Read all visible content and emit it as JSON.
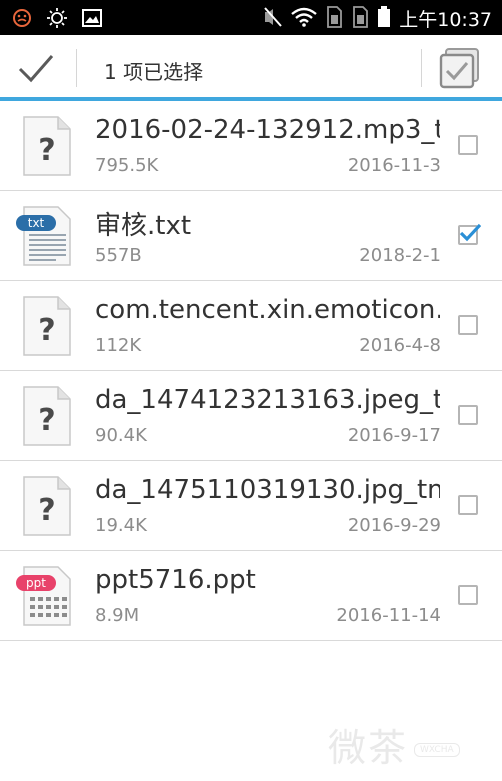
{
  "status_bar": {
    "time": "上午10:37",
    "left_icons": [
      "emoji-icon",
      "brightness-icon",
      "image-icon"
    ],
    "right_icons": [
      "mute-icon",
      "wifi-icon",
      "sim1-icon",
      "sim2-icon",
      "battery-icon"
    ]
  },
  "action_bar": {
    "title": "1 项已选择"
  },
  "colors": {
    "accent": "#3fa7de",
    "checkbox_checked": "#2a8fd6",
    "text_primary": "#333333",
    "text_secondary": "#8c8c8c"
  },
  "files": [
    {
      "name": "2016-02-24-132912.mp3_t",
      "size": "795.5K",
      "date": "2016-11-3",
      "icon": "unknown-file-icon",
      "checked": false
    },
    {
      "name": "审核.txt",
      "size": "557B",
      "date": "2018-2-1",
      "icon": "txt-file-icon",
      "icon_label": "txt",
      "checked": true
    },
    {
      "name": "com.tencent.xin.emoticon.",
      "size": "112K",
      "date": "2016-4-8",
      "icon": "unknown-file-icon",
      "checked": false
    },
    {
      "name": "da_1474123213163.jpeg_t",
      "size": "90.4K",
      "date": "2016-9-17",
      "icon": "unknown-file-icon",
      "checked": false
    },
    {
      "name": "da_1475110319130.jpg_tn",
      "size": "19.4K",
      "date": "2016-9-29",
      "icon": "unknown-file-icon",
      "checked": false
    },
    {
      "name": "ppt5716.ppt",
      "size": "8.9M",
      "date": "2016-11-14",
      "icon": "ppt-file-icon",
      "icon_label": "ppt",
      "checked": false
    }
  ],
  "watermark": {
    "text": "微茶",
    "sub": "WXCHA"
  }
}
